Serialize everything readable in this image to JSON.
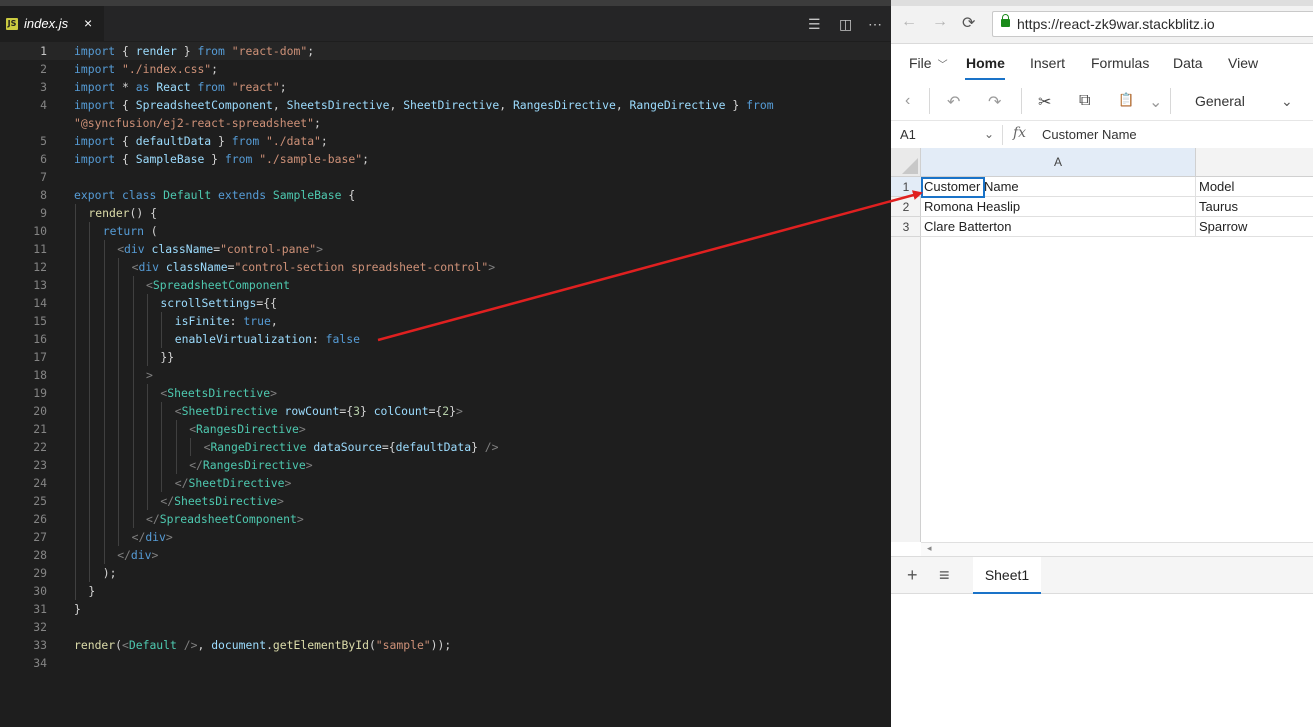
{
  "editor": {
    "tab": {
      "icon": "JS",
      "title": "index.js",
      "close": "×"
    },
    "actions": [
      "☰",
      "◫",
      "⋯"
    ],
    "lines": [
      {
        "n": "1",
        "active": true,
        "indent": 0,
        "tokens": [
          [
            "k",
            "import"
          ],
          [
            "pl",
            " { "
          ],
          [
            "v",
            "render"
          ],
          [
            "pl",
            " } "
          ],
          [
            "k",
            "from"
          ],
          [
            "pl",
            " "
          ],
          [
            "s",
            "\"react-dom\""
          ],
          [
            "pl",
            ";"
          ]
        ]
      },
      {
        "n": "2",
        "indent": 0,
        "tokens": [
          [
            "k",
            "import"
          ],
          [
            "pl",
            " "
          ],
          [
            "s",
            "\"./index.css\""
          ],
          [
            "pl",
            ";"
          ]
        ]
      },
      {
        "n": "3",
        "indent": 0,
        "tokens": [
          [
            "k",
            "import"
          ],
          [
            "pl",
            " * "
          ],
          [
            "k",
            "as"
          ],
          [
            "pl",
            " "
          ],
          [
            "v",
            "React"
          ],
          [
            "pl",
            " "
          ],
          [
            "k",
            "from"
          ],
          [
            "pl",
            " "
          ],
          [
            "s",
            "\"react\""
          ],
          [
            "pl",
            ";"
          ]
        ]
      },
      {
        "n": "4",
        "indent": 0,
        "tokens": [
          [
            "k",
            "import"
          ],
          [
            "pl",
            " { "
          ],
          [
            "v",
            "SpreadsheetComponent"
          ],
          [
            "pl",
            ", "
          ],
          [
            "v",
            "SheetsDirective"
          ],
          [
            "pl",
            ", "
          ],
          [
            "v",
            "SheetDirective"
          ],
          [
            "pl",
            ", "
          ],
          [
            "v",
            "RangesDirective"
          ],
          [
            "pl",
            ", "
          ],
          [
            "v",
            "RangeDirective"
          ],
          [
            "pl",
            " } "
          ],
          [
            "k",
            "from"
          ]
        ]
      },
      {
        "n": "",
        "indent": 0,
        "tokens": [
          [
            "s",
            "\"@syncfusion/ej2-react-spreadsheet\""
          ],
          [
            "pl",
            ";"
          ]
        ]
      },
      {
        "n": "5",
        "indent": 0,
        "tokens": [
          [
            "k",
            "import"
          ],
          [
            "pl",
            " { "
          ],
          [
            "v",
            "defaultData"
          ],
          [
            "pl",
            " } "
          ],
          [
            "k",
            "from"
          ],
          [
            "pl",
            " "
          ],
          [
            "s",
            "\"./data\""
          ],
          [
            "pl",
            ";"
          ]
        ]
      },
      {
        "n": "6",
        "indent": 0,
        "tokens": [
          [
            "k",
            "import"
          ],
          [
            "pl",
            " { "
          ],
          [
            "v",
            "SampleBase"
          ],
          [
            "pl",
            " } "
          ],
          [
            "k",
            "from"
          ],
          [
            "pl",
            " "
          ],
          [
            "s",
            "\"./sample-base\""
          ],
          [
            "pl",
            ";"
          ]
        ]
      },
      {
        "n": "7",
        "indent": 0,
        "tokens": []
      },
      {
        "n": "8",
        "indent": 0,
        "tokens": [
          [
            "k",
            "export"
          ],
          [
            "pl",
            " "
          ],
          [
            "k",
            "class"
          ],
          [
            "pl",
            " "
          ],
          [
            "t",
            "Default"
          ],
          [
            "pl",
            " "
          ],
          [
            "k",
            "extends"
          ],
          [
            "pl",
            " "
          ],
          [
            "t",
            "SampleBase"
          ],
          [
            "pl",
            " {"
          ]
        ]
      },
      {
        "n": "9",
        "indent": 1,
        "tokens": [
          [
            "f",
            "render"
          ],
          [
            "pl",
            "() {"
          ]
        ]
      },
      {
        "n": "10",
        "indent": 2,
        "tokens": [
          [
            "k",
            "return"
          ],
          [
            "pl",
            " ("
          ]
        ]
      },
      {
        "n": "11",
        "indent": 3,
        "tokens": [
          [
            "p",
            "<"
          ],
          [
            "k",
            "div"
          ],
          [
            "pl",
            " "
          ],
          [
            "v",
            "className"
          ],
          [
            "pl",
            "="
          ],
          [
            "s",
            "\"control-pane\""
          ],
          [
            "p",
            ">"
          ]
        ]
      },
      {
        "n": "12",
        "indent": 4,
        "tokens": [
          [
            "p",
            "<"
          ],
          [
            "k",
            "div"
          ],
          [
            "pl",
            " "
          ],
          [
            "v",
            "className"
          ],
          [
            "pl",
            "="
          ],
          [
            "s",
            "\"control-section spreadsheet-control\""
          ],
          [
            "p",
            ">"
          ]
        ]
      },
      {
        "n": "13",
        "indent": 5,
        "tokens": [
          [
            "p",
            "<"
          ],
          [
            "t",
            "SpreadsheetComponent"
          ]
        ]
      },
      {
        "n": "14",
        "indent": 6,
        "tokens": [
          [
            "v",
            "scrollSettings"
          ],
          [
            "pl",
            "={{"
          ]
        ]
      },
      {
        "n": "15",
        "indent": 7,
        "tokens": [
          [
            "v",
            "isFinite"
          ],
          [
            "pl",
            ": "
          ],
          [
            "k",
            "true"
          ],
          [
            "pl",
            ","
          ]
        ]
      },
      {
        "n": "16",
        "indent": 7,
        "tokens": [
          [
            "v",
            "enableVirtualization"
          ],
          [
            "pl",
            ": "
          ],
          [
            "k",
            "false"
          ]
        ]
      },
      {
        "n": "17",
        "indent": 6,
        "tokens": [
          [
            "pl",
            "}}"
          ]
        ]
      },
      {
        "n": "18",
        "indent": 5,
        "tokens": [
          [
            "p",
            ">"
          ]
        ]
      },
      {
        "n": "19",
        "indent": 6,
        "tokens": [
          [
            "p",
            "<"
          ],
          [
            "t",
            "SheetsDirective"
          ],
          [
            "p",
            ">"
          ]
        ]
      },
      {
        "n": "20",
        "indent": 7,
        "tokens": [
          [
            "p",
            "<"
          ],
          [
            "t",
            "SheetDirective"
          ],
          [
            "pl",
            " "
          ],
          [
            "v",
            "rowCount"
          ],
          [
            "pl",
            "={"
          ],
          [
            "n",
            "3"
          ],
          [
            "pl",
            "} "
          ],
          [
            "v",
            "colCount"
          ],
          [
            "pl",
            "={"
          ],
          [
            "n",
            "2"
          ],
          [
            "pl",
            "}"
          ],
          [
            "p",
            ">"
          ]
        ]
      },
      {
        "n": "21",
        "indent": 8,
        "tokens": [
          [
            "p",
            "<"
          ],
          [
            "t",
            "RangesDirective"
          ],
          [
            "p",
            ">"
          ]
        ]
      },
      {
        "n": "22",
        "indent": 9,
        "tokens": [
          [
            "p",
            "<"
          ],
          [
            "t",
            "RangeDirective"
          ],
          [
            "pl",
            " "
          ],
          [
            "v",
            "dataSource"
          ],
          [
            "pl",
            "={"
          ],
          [
            "v",
            "defaultData"
          ],
          [
            "pl",
            "} "
          ],
          [
            "p",
            "/>"
          ]
        ]
      },
      {
        "n": "23",
        "indent": 8,
        "tokens": [
          [
            "p",
            "</"
          ],
          [
            "t",
            "RangesDirective"
          ],
          [
            "p",
            ">"
          ]
        ]
      },
      {
        "n": "24",
        "indent": 7,
        "tokens": [
          [
            "p",
            "</"
          ],
          [
            "t",
            "SheetDirective"
          ],
          [
            "p",
            ">"
          ]
        ]
      },
      {
        "n": "25",
        "indent": 6,
        "tokens": [
          [
            "p",
            "</"
          ],
          [
            "t",
            "SheetsDirective"
          ],
          [
            "p",
            ">"
          ]
        ]
      },
      {
        "n": "26",
        "indent": 5,
        "tokens": [
          [
            "p",
            "</"
          ],
          [
            "t",
            "SpreadsheetComponent"
          ],
          [
            "p",
            ">"
          ]
        ]
      },
      {
        "n": "27",
        "indent": 4,
        "tokens": [
          [
            "p",
            "</"
          ],
          [
            "k",
            "div"
          ],
          [
            "p",
            ">"
          ]
        ]
      },
      {
        "n": "28",
        "indent": 3,
        "tokens": [
          [
            "p",
            "</"
          ],
          [
            "k",
            "div"
          ],
          [
            "p",
            ">"
          ]
        ]
      },
      {
        "n": "29",
        "indent": 2,
        "tokens": [
          [
            "pl",
            ");"
          ]
        ]
      },
      {
        "n": "30",
        "indent": 1,
        "tokens": [
          [
            "pl",
            "}"
          ]
        ]
      },
      {
        "n": "31",
        "indent": 0,
        "tokens": [
          [
            "pl",
            "}"
          ]
        ]
      },
      {
        "n": "32",
        "indent": 0,
        "tokens": []
      },
      {
        "n": "33",
        "indent": 0,
        "tokens": [
          [
            "f",
            "render"
          ],
          [
            "pl",
            "("
          ],
          [
            "p",
            "<"
          ],
          [
            "t",
            "Default"
          ],
          [
            "pl",
            " "
          ],
          [
            "p",
            "/>"
          ],
          [
            "pl",
            ", "
          ],
          [
            "v",
            "document"
          ],
          [
            "pl",
            "."
          ],
          [
            "f",
            "getElementById"
          ],
          [
            "pl",
            "("
          ],
          [
            "s",
            "\"sample\""
          ],
          [
            "pl",
            "));"
          ]
        ]
      },
      {
        "n": "34",
        "indent": 0,
        "tokens": []
      }
    ]
  },
  "browser": {
    "nav": {
      "back": "←",
      "forward": "→",
      "reload": "⟳"
    },
    "url": "https://react-zk9war.stackblitz.io",
    "menu": [
      {
        "label": "File",
        "active": false,
        "dropdown": "﹀"
      },
      {
        "label": "Home",
        "active": true
      },
      {
        "label": "Insert",
        "active": false
      },
      {
        "label": "Formulas",
        "active": false
      },
      {
        "label": "Data",
        "active": false
      },
      {
        "label": "View",
        "active": false
      }
    ],
    "toolbar": {
      "icons": [
        "‹",
        "↶",
        "↷",
        "✂",
        "⧉",
        "📋",
        "⌄"
      ],
      "format": "General",
      "format_chevron": "⌄"
    },
    "formula_bar": {
      "name_box": "A1",
      "name_box_chevron": "⌄",
      "fx": "fx",
      "value": "Customer Name"
    },
    "grid": {
      "columns": [
        "A",
        ""
      ],
      "rows": [
        {
          "num": "1",
          "cells": [
            "Customer Name",
            "Model"
          ]
        },
        {
          "num": "2",
          "cells": [
            "Romona Heaslip",
            "Taurus"
          ]
        },
        {
          "num": "3",
          "cells": [
            "Clare Batterton",
            "Sparrow"
          ]
        }
      ],
      "active_cell": "A1"
    },
    "scroll_arrow": "◂",
    "sheet_bar": {
      "add": "+",
      "list": "≡",
      "tab": "Sheet1"
    }
  },
  "annotation": {
    "color": "#e02020"
  }
}
